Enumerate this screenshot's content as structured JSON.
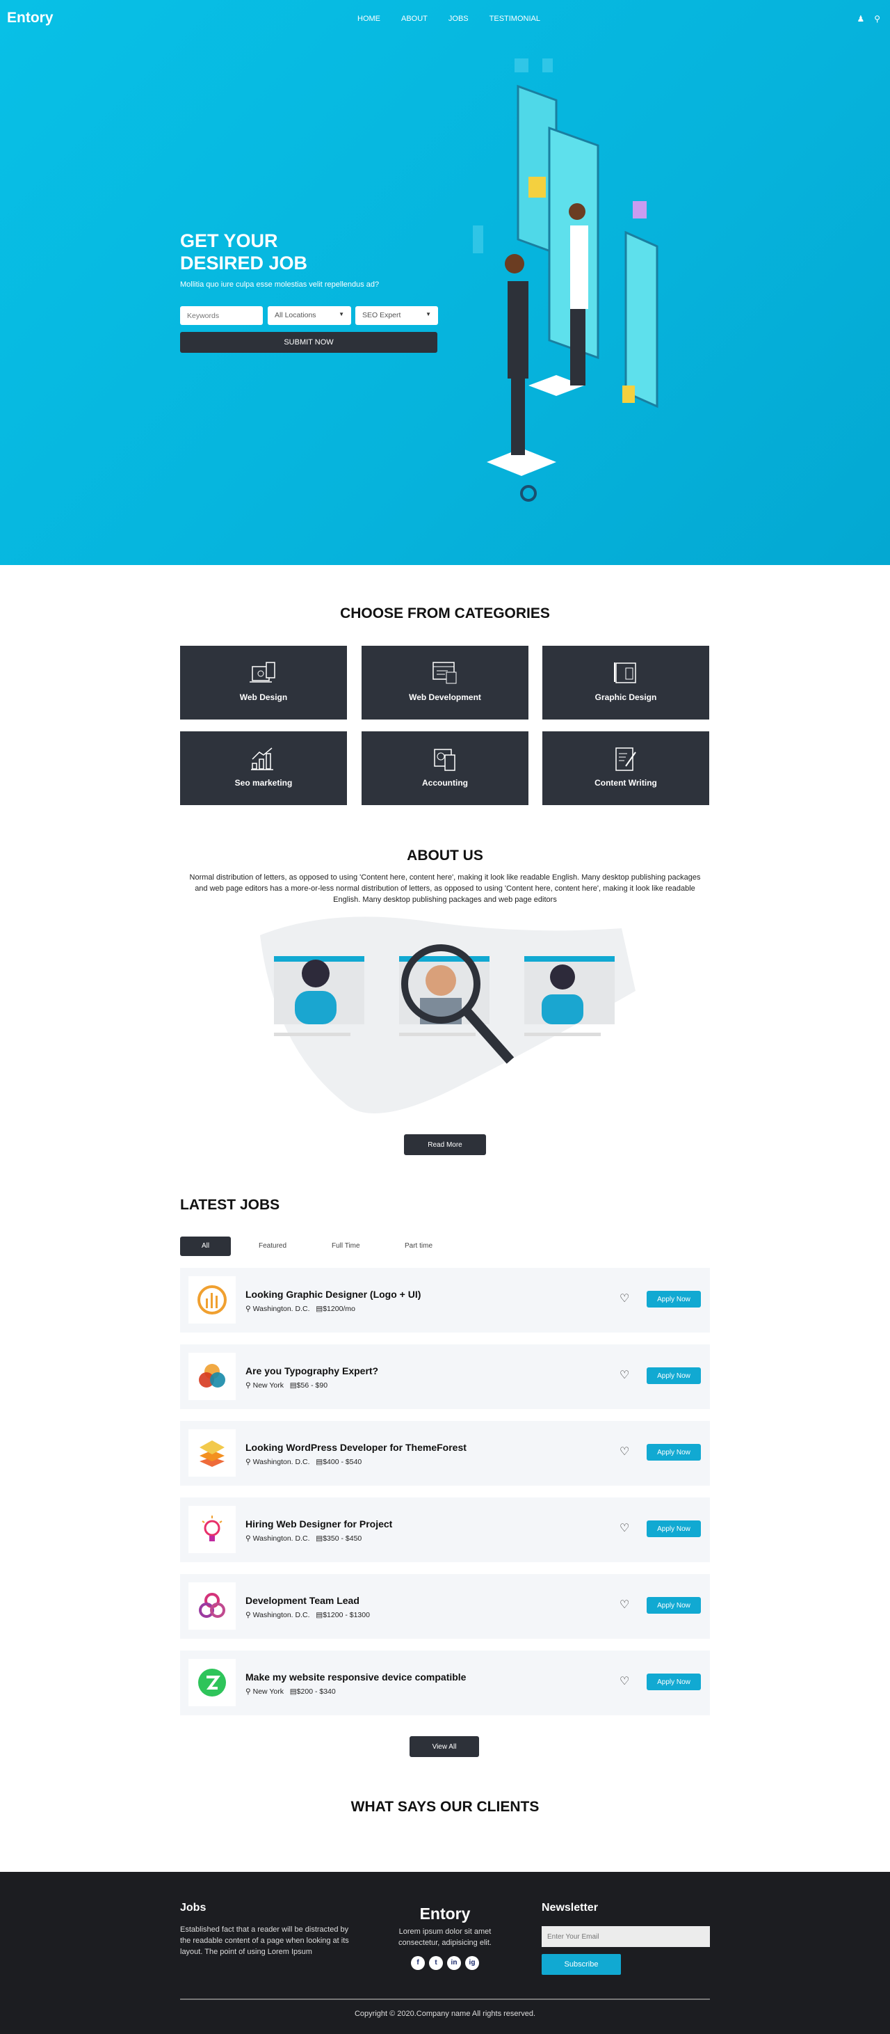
{
  "header": {
    "logo": "Entory",
    "nav": [
      "HOME",
      "ABOUT",
      "JOBS",
      "TESTIMONIAL"
    ],
    "icons": [
      "user-icon",
      "search-icon"
    ]
  },
  "hero": {
    "title_line1": "GET YOUR",
    "title_line2": "DESIRED JOB",
    "subtitle": "Mollitia quo iure culpa esse molestias velit repellendus ad?",
    "keywords_placeholder": "Keywords",
    "location_value": "All Locations",
    "category_value": "SEO Expert",
    "submit": "SUBMIT NOW"
  },
  "categories": {
    "title": "CHOOSE FROM CATEGORIES",
    "items": [
      "Web Design",
      "Web Development",
      "Graphic Design",
      "Seo marketing",
      "Accounting",
      "Content Writing"
    ]
  },
  "about": {
    "title": "ABOUT US",
    "text": "Normal distribution of letters, as opposed to using 'Content here, content here', making it look like readable English. Many desktop publishing packages and web page editors has a more-or-less normal distribution of letters, as opposed to using 'Content here, content here', making it look like readable English. Many desktop publishing packages and web page editors",
    "button": "Read More"
  },
  "jobs": {
    "title": "LATEST JOBS",
    "tabs": [
      "All",
      "Featured",
      "Full Time",
      "Part time"
    ],
    "apply": "Apply Now",
    "view_all": "View All",
    "items": [
      {
        "title": "Looking Graphic Designer (Logo + UI)",
        "location": "Washington. D.C.",
        "salary": "$1200/mo"
      },
      {
        "title": "Are you Typography Expert?",
        "location": "New York",
        "salary": "$56 - $90"
      },
      {
        "title": "Looking WordPress Developer for ThemeForest",
        "location": "Washington. D.C.",
        "salary": "$400 - $540"
      },
      {
        "title": "Hiring Web Designer for Project",
        "location": "Washington. D.C.",
        "salary": "$350 - $450"
      },
      {
        "title": "Development Team Lead",
        "location": "Washington. D.C.",
        "salary": "$1200 - $1300"
      },
      {
        "title": "Make my website responsive device compatible",
        "location": "New York",
        "salary": "$200 - $340"
      }
    ]
  },
  "testimonials": {
    "title": "WHAT SAYS OUR CLIENTS"
  },
  "footer": {
    "jobs_title": "Jobs",
    "jobs_text": "Established fact that a reader will be distracted by the readable content of a page when looking at its layout. The point of using Lorem Ipsum",
    "brand": "Entory",
    "brand_text": "Lorem ipsum dolor sit amet consectetur, adipisicing elit.",
    "social": [
      "f",
      "t",
      "in",
      "ig"
    ],
    "newsletter_title": "Newsletter",
    "email_placeholder": "Enter Your Email",
    "subscribe": "Subscribe",
    "copyright": "Copyright © 2020.Company name All rights reserved."
  },
  "colors": {
    "hero": "#08bde4",
    "dark": "#2d3139",
    "accent": "#11a9d2",
    "footer": "#1c1d21"
  }
}
